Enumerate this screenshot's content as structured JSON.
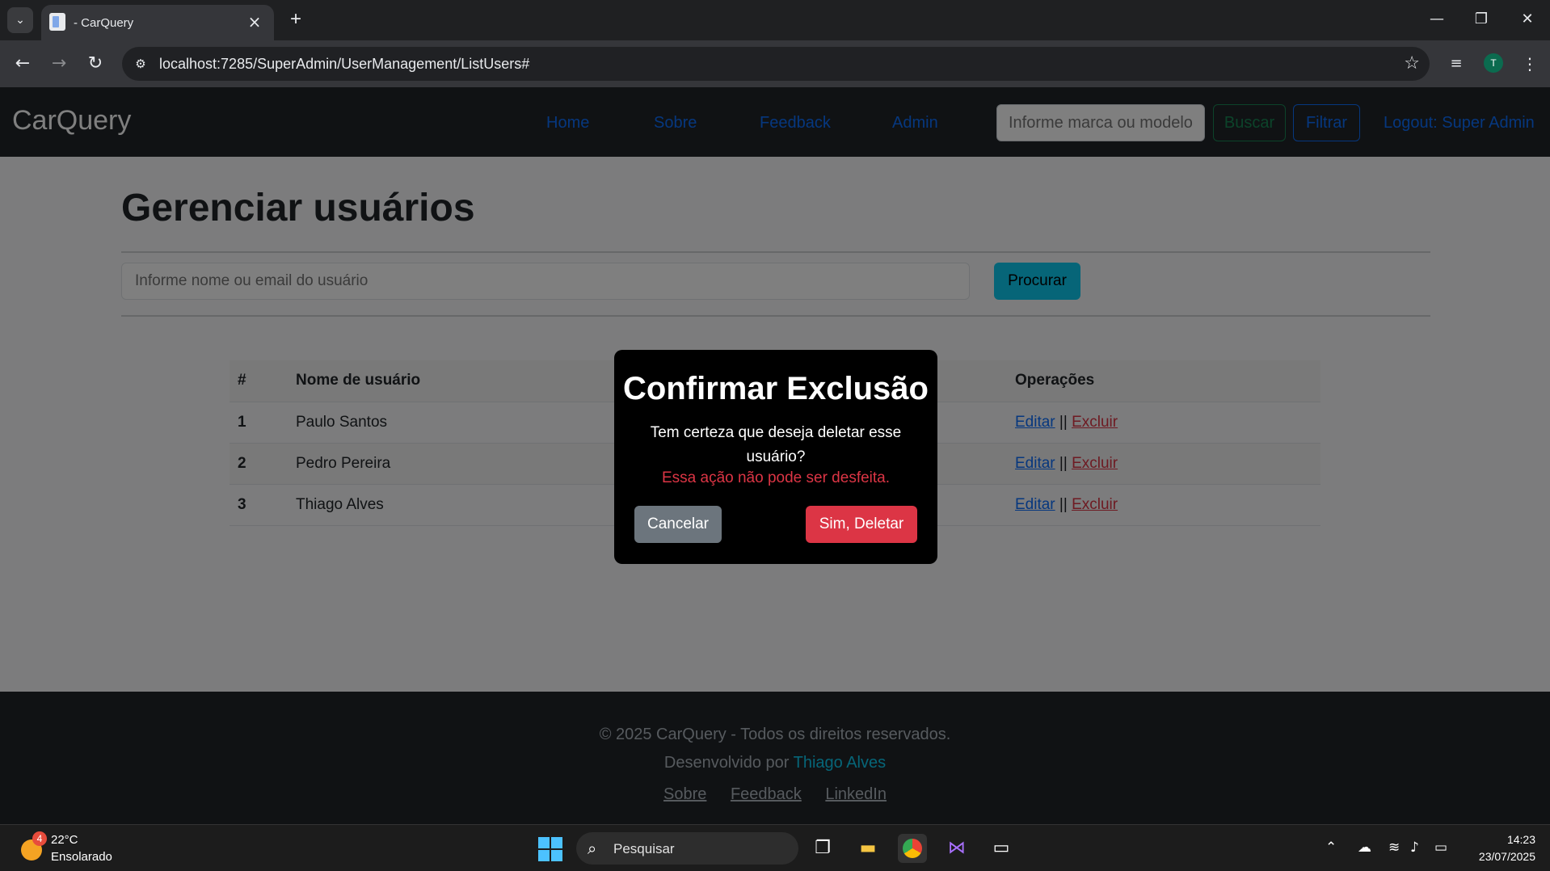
{
  "browser": {
    "tab_title": "- CarQuery",
    "url": "localhost:7285/SuperAdmin/UserManagement/ListUsers#",
    "profile_initial": "T"
  },
  "site": {
    "brand": "CarQuery",
    "nav": {
      "home": "Home",
      "about": "Sobre",
      "feedback": "Feedback",
      "admin": "Admin",
      "search_placeholder": "Informe marca ou modelo",
      "search_button": "Buscar",
      "filter_button": "Filtrar",
      "logout": "Logout: Super Admin"
    },
    "colors": {
      "primary": "#0d6efd",
      "info": "#0dcaf0",
      "danger": "#dc3545",
      "success": "#198754",
      "dark": "#212529"
    }
  },
  "page": {
    "title": "Gerenciar usuários",
    "search_placeholder": "Informe nome ou email do usuário",
    "search_button": "Procurar",
    "table": {
      "headers": [
        "#",
        "Nome de usuário",
        "",
        "Operações"
      ],
      "rows": [
        {
          "index": "1",
          "name": "Paulo Santos",
          "edit": "Editar",
          "sep": "||",
          "delete": "Excluir"
        },
        {
          "index": "2",
          "name": "Pedro Pereira",
          "edit": "Editar",
          "sep": "||",
          "delete": "Excluir"
        },
        {
          "index": "3",
          "name": "Thiago Alves",
          "edit": "Editar",
          "sep": "||",
          "delete": "Excluir"
        }
      ]
    }
  },
  "modal": {
    "title": "Confirmar Exclusão",
    "body": "Tem certeza que deseja deletar esse usuário?",
    "warning": "Essa ação não pode ser desfeita.",
    "cancel": "Cancelar",
    "confirm": "Sim, Deletar"
  },
  "footer": {
    "copyright": "© 2025 CarQuery - Todos os direitos reservados.",
    "dev_prefix": "Desenvolvido por",
    "dev_name": "Thiago Alves",
    "links": [
      "Sobre",
      "Feedback",
      "LinkedIn"
    ]
  },
  "taskbar": {
    "weather_badge": "4",
    "temperature": "22°C",
    "weather_desc": "Ensolarado",
    "search_text": "Pesquisar",
    "time": "14:23",
    "date": "23/07/2025"
  }
}
